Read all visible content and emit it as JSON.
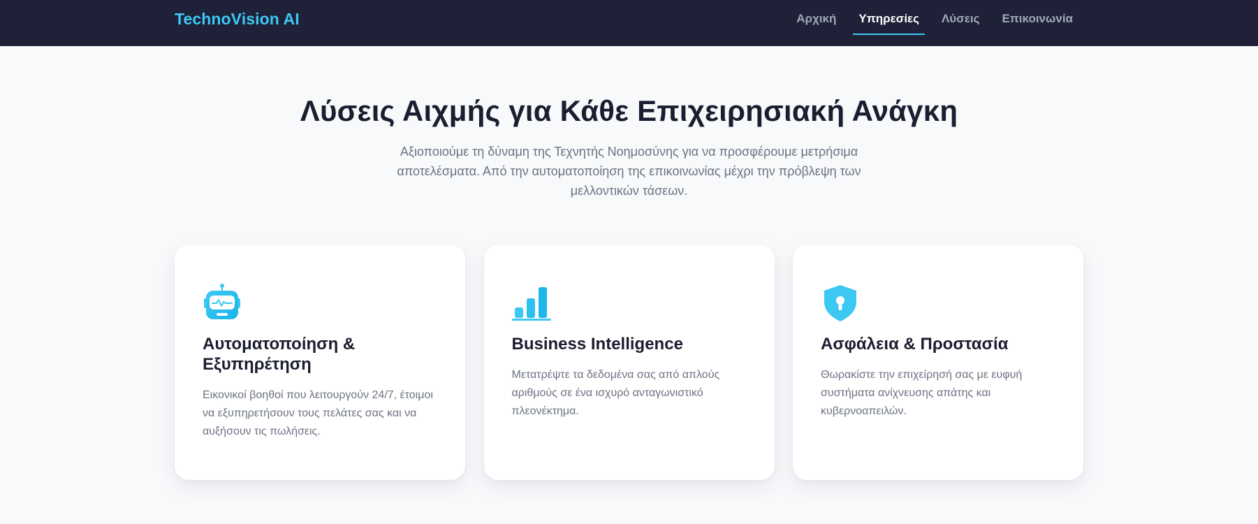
{
  "navbar": {
    "brand": "TechnoVision AI",
    "links": [
      {
        "label": "Αρχική",
        "active": false
      },
      {
        "label": "Υπηρεσίες",
        "active": true
      },
      {
        "label": "Λύσεις",
        "active": false
      },
      {
        "label": "Επικοινωνία",
        "active": false
      }
    ]
  },
  "hero": {
    "title": "Λύσεις Αιχμής για Κάθε Επιχειρησιακή Ανάγκη",
    "subtitle": "Αξιοποιούμε τη δύναμη της Τεχνητής Νοημοσύνης για να προσφέρουμε μετρήσιμα αποτελέσματα. Από την αυτοματοποίηση της επικοινωνίας μέχρι την πρόβλεψη των μελλοντικών τάσεων."
  },
  "cards": [
    {
      "icon": "robot-icon",
      "title": "Αυτοματοποίηση & Εξυπηρέτηση",
      "text": "Εικονικοί βοηθοί που λειτουργούν 24/7, έτοιμοι να εξυπηρετήσουν τους πελάτες σας και να αυξήσουν τις πωλήσεις."
    },
    {
      "icon": "bar-chart-icon",
      "title": "Business Intelligence",
      "text": "Μετατρέψτε τα δεδομένα σας από απλούς αριθμούς σε ένα ισχυρό ανταγωνιστικό πλεονέκτημα."
    },
    {
      "icon": "shield-lock-icon",
      "title": "Ασφάλεια & Προστασία",
      "text": "Θωρακίστε την επιχείρησή σας με ευφυή συστήματα ανίχνευσης απάτης και κυβερνοαπειλών."
    }
  ],
  "colors": {
    "navbar_bg": "#1e2137",
    "accent": "#3dc8f4",
    "page_bg": "#f7f9fb",
    "heading": "#1b1d30",
    "muted_text": "#6c7282"
  }
}
